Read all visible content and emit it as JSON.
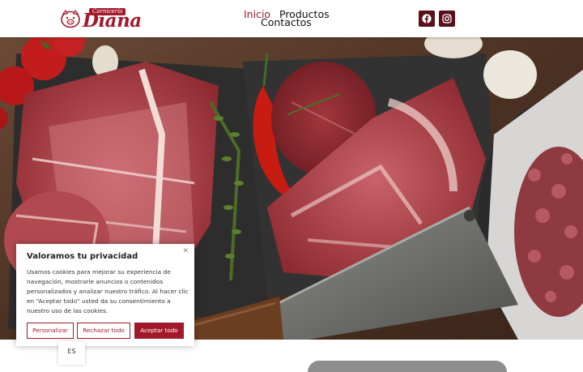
{
  "header": {
    "logo": {
      "small_text": "Carnicería",
      "brand_text": "Diana",
      "icon": "pig-icon"
    },
    "nav": [
      {
        "label": "Inicio",
        "active": true
      },
      {
        "label": "Productos",
        "active": false
      },
      {
        "label": "Contactos",
        "active": false
      }
    ],
    "social": [
      {
        "icon": "facebook-icon"
      },
      {
        "icon": "instagram-icon"
      }
    ]
  },
  "hero": {
    "image": "raw-meat-cuts-on-board"
  },
  "cookie_banner": {
    "title": "Valoramos tu privacidad",
    "text": "Usamos cookies para mejorar su experiencia de navegación, mostrarle anuncios o contenidos personalizados y analizar nuestro tráfico. Al hacer clic en “Aceptar todo” usted da su consentimiento a nuestro uso de las cookies.",
    "close_icon": "close-icon",
    "buttons": {
      "personalizar": "Personalizar",
      "rechazar": "Rechazar todo",
      "aceptar": "Aceptar todo"
    }
  },
  "language": {
    "current": "ES"
  },
  "colors": {
    "brand": "#a21a2a",
    "social_bg": "#5a0f1c"
  }
}
